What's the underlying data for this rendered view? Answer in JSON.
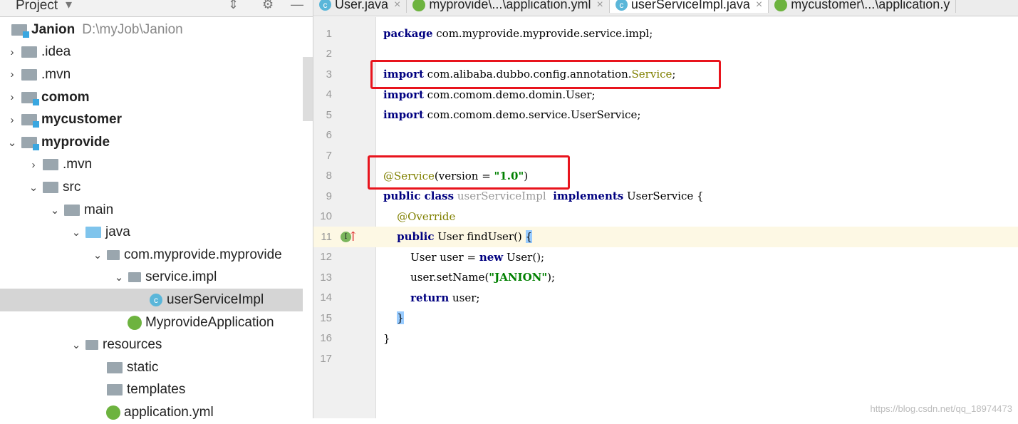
{
  "project_panel": {
    "title": "Project",
    "tree": [
      {
        "label": "Janion",
        "path": "D:\\myJob\\Janion",
        "depth": 0,
        "arrow": "",
        "icon": "module-folder",
        "bold": true
      },
      {
        "label": ".idea",
        "depth": 0,
        "arrow": "right",
        "icon": "folder"
      },
      {
        "label": ".mvn",
        "depth": 0,
        "arrow": "right",
        "icon": "folder"
      },
      {
        "label": "comom",
        "depth": 0,
        "arrow": "right",
        "icon": "module-folder",
        "bold": true
      },
      {
        "label": "mycustomer",
        "depth": 0,
        "arrow": "right",
        "icon": "module-folder",
        "bold": true
      },
      {
        "label": "myprovide",
        "depth": 0,
        "arrow": "down",
        "icon": "module-folder",
        "bold": true
      },
      {
        "label": ".mvn",
        "depth": 1,
        "arrow": "right",
        "icon": "folder"
      },
      {
        "label": "src",
        "depth": 1,
        "arrow": "down",
        "icon": "folder"
      },
      {
        "label": "main",
        "depth": 2,
        "arrow": "down",
        "icon": "folder"
      },
      {
        "label": "java",
        "depth": 3,
        "arrow": "down",
        "icon": "source-folder"
      },
      {
        "label": "com.myprovide.myprovide",
        "depth": 4,
        "arrow": "down",
        "icon": "package"
      },
      {
        "label": "service.impl",
        "depth": 5,
        "arrow": "down",
        "icon": "package"
      },
      {
        "label": "userServiceImpl",
        "depth": 6,
        "arrow": "",
        "icon": "class",
        "selected": true
      },
      {
        "label": "MyprovideApplication",
        "depth": 5,
        "arrow": "",
        "icon": "spring-class"
      },
      {
        "label": "resources",
        "depth": 3,
        "arrow": "down",
        "icon": "resources-folder"
      },
      {
        "label": "static",
        "depth": 4,
        "arrow": "",
        "icon": "folder"
      },
      {
        "label": "templates",
        "depth": 4,
        "arrow": "",
        "icon": "folder"
      },
      {
        "label": "application.yml",
        "depth": 4,
        "arrow": "",
        "icon": "spring-file"
      }
    ]
  },
  "tabs": [
    {
      "label": "User.java",
      "icon": "class",
      "active": false
    },
    {
      "label": "myprovide\\...\\application.yml",
      "icon": "spring-file",
      "active": false
    },
    {
      "label": "userServiceImpl.java",
      "icon": "class",
      "active": true
    },
    {
      "label": "mycustomer\\...\\application.y",
      "icon": "spring-file",
      "active": false
    }
  ],
  "close_symbol": "×",
  "code_lines": [
    [
      [
        "package",
        "kw"
      ],
      [
        " com.myprovide.myprovide.service.impl;",
        ""
      ]
    ],
    [],
    [
      [
        "import",
        "kw"
      ],
      [
        " com.alibaba.dubbo.config.annotation.",
        ""
      ],
      [
        "Service",
        "an"
      ],
      [
        ";",
        ""
      ]
    ],
    [
      [
        "import",
        "kw"
      ],
      [
        " com.comom.demo.domin.User;",
        ""
      ]
    ],
    [
      [
        "import",
        "kw"
      ],
      [
        " com.comom.demo.service.UserService;",
        ""
      ]
    ],
    [],
    [],
    [
      [
        "@Service",
        "an"
      ],
      [
        "(version = ",
        ""
      ],
      [
        "\"1.0\"",
        "st"
      ],
      [
        ")",
        ""
      ]
    ],
    [
      [
        "public class",
        "kw"
      ],
      [
        " ",
        ""
      ],
      [
        "userServiceImpl",
        "it"
      ],
      [
        "  ",
        ""
      ],
      [
        "implements",
        "kw"
      ],
      [
        " UserService {",
        ""
      ]
    ],
    [
      [
        "    ",
        ""
      ],
      [
        "@Override",
        "an"
      ]
    ],
    [
      [
        "    ",
        ""
      ],
      [
        "public",
        "kw"
      ],
      [
        " User findUser() ",
        ""
      ],
      [
        "{",
        "hl"
      ]
    ],
    [
      [
        "        User user = ",
        ""
      ],
      [
        "new",
        "kw"
      ],
      [
        " User();",
        ""
      ]
    ],
    [
      [
        "        user.setName(",
        ""
      ],
      [
        "\"JANION\"",
        "st"
      ],
      [
        ");",
        ""
      ]
    ],
    [
      [
        "        ",
        ""
      ],
      [
        "return",
        "kw"
      ],
      [
        " user;",
        ""
      ]
    ],
    [
      [
        "    ",
        ""
      ],
      [
        "}",
        "hl"
      ]
    ],
    [
      [
        "}",
        ""
      ]
    ],
    []
  ],
  "current_line": 11,
  "watermark": "https://blog.csdn.net/qq_18974473"
}
